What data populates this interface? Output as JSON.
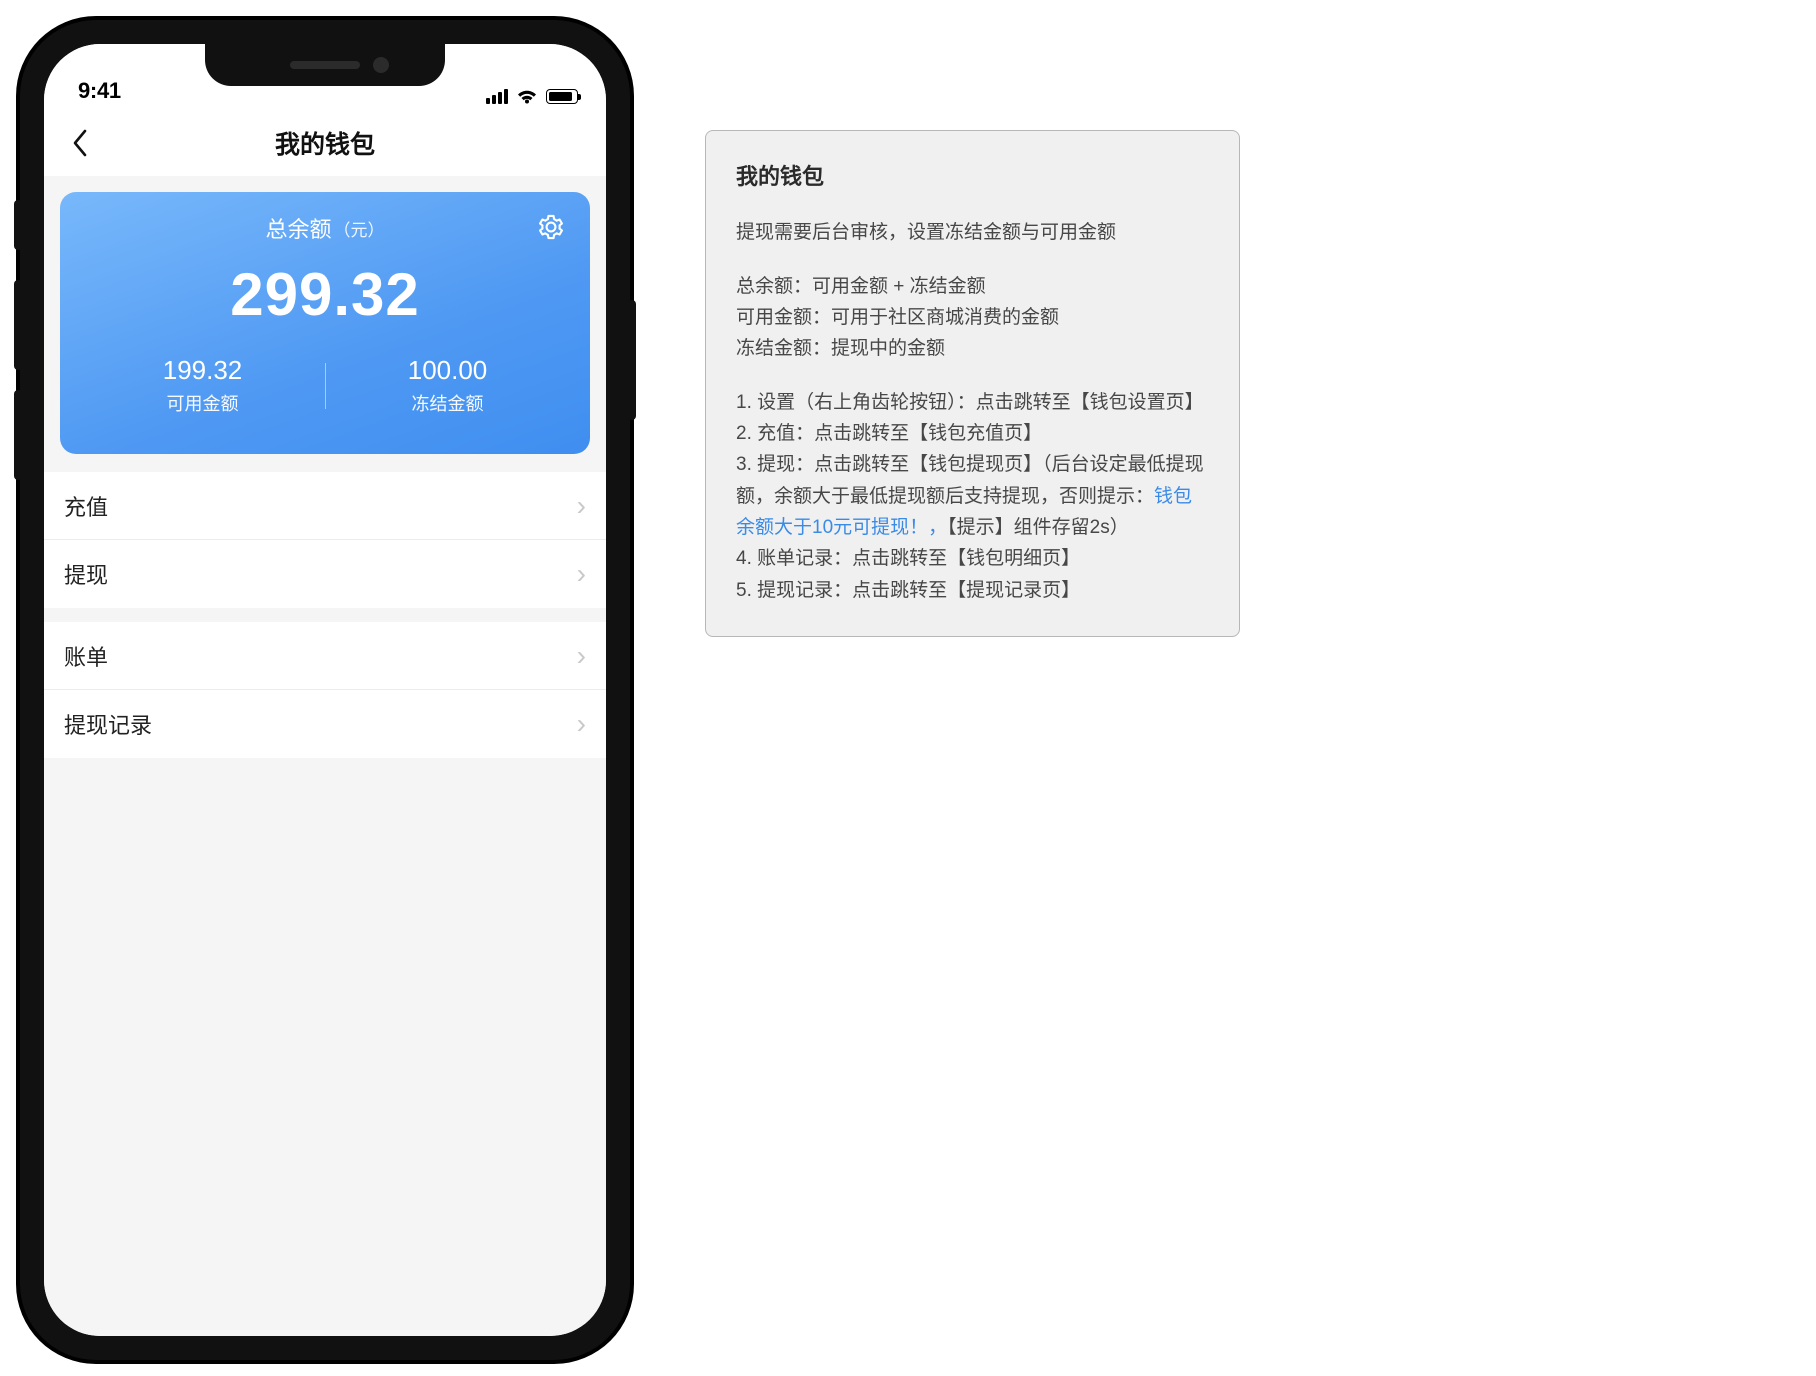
{
  "status": {
    "time": "9:41"
  },
  "nav": {
    "title": "我的钱包"
  },
  "balance": {
    "head_label": "总余额",
    "head_unit": "（元）",
    "total": "299.32",
    "available_value": "199.32",
    "available_label": "可用金额",
    "frozen_value": "100.00",
    "frozen_label": "冻结金额"
  },
  "menu": {
    "group1": [
      {
        "label": "充值"
      },
      {
        "label": "提现"
      }
    ],
    "group2": [
      {
        "label": "账单"
      },
      {
        "label": "提现记录"
      }
    ]
  },
  "spec": {
    "title": "我的钱包",
    "intro": "提现需要后台审核，设置冻结金额与可用金额",
    "def1": "总余额：可用金额 + 冻结金额",
    "def2": "可用金额：可用于社区商城消费的金额",
    "def3": "冻结金额：提现中的金额",
    "n1": "1. 设置（右上角齿轮按钮）：点击跳转至【钱包设置页】",
    "n2": "2. 充值：点击跳转至【钱包充值页】",
    "n3a": "3. 提现：点击跳转至【钱包提现页】（后台设定最低提现额，余额大于最低提现额后支持提现，否则提示：",
    "n3_tip": "钱包余额大于10元可提现！，",
    "n3b": "【提示】组件存留2s）",
    "n4": "4. 账单记录：点击跳转至【钱包明细页】",
    "n5": "5. 提现记录：点击跳转至【提现记录页】"
  }
}
